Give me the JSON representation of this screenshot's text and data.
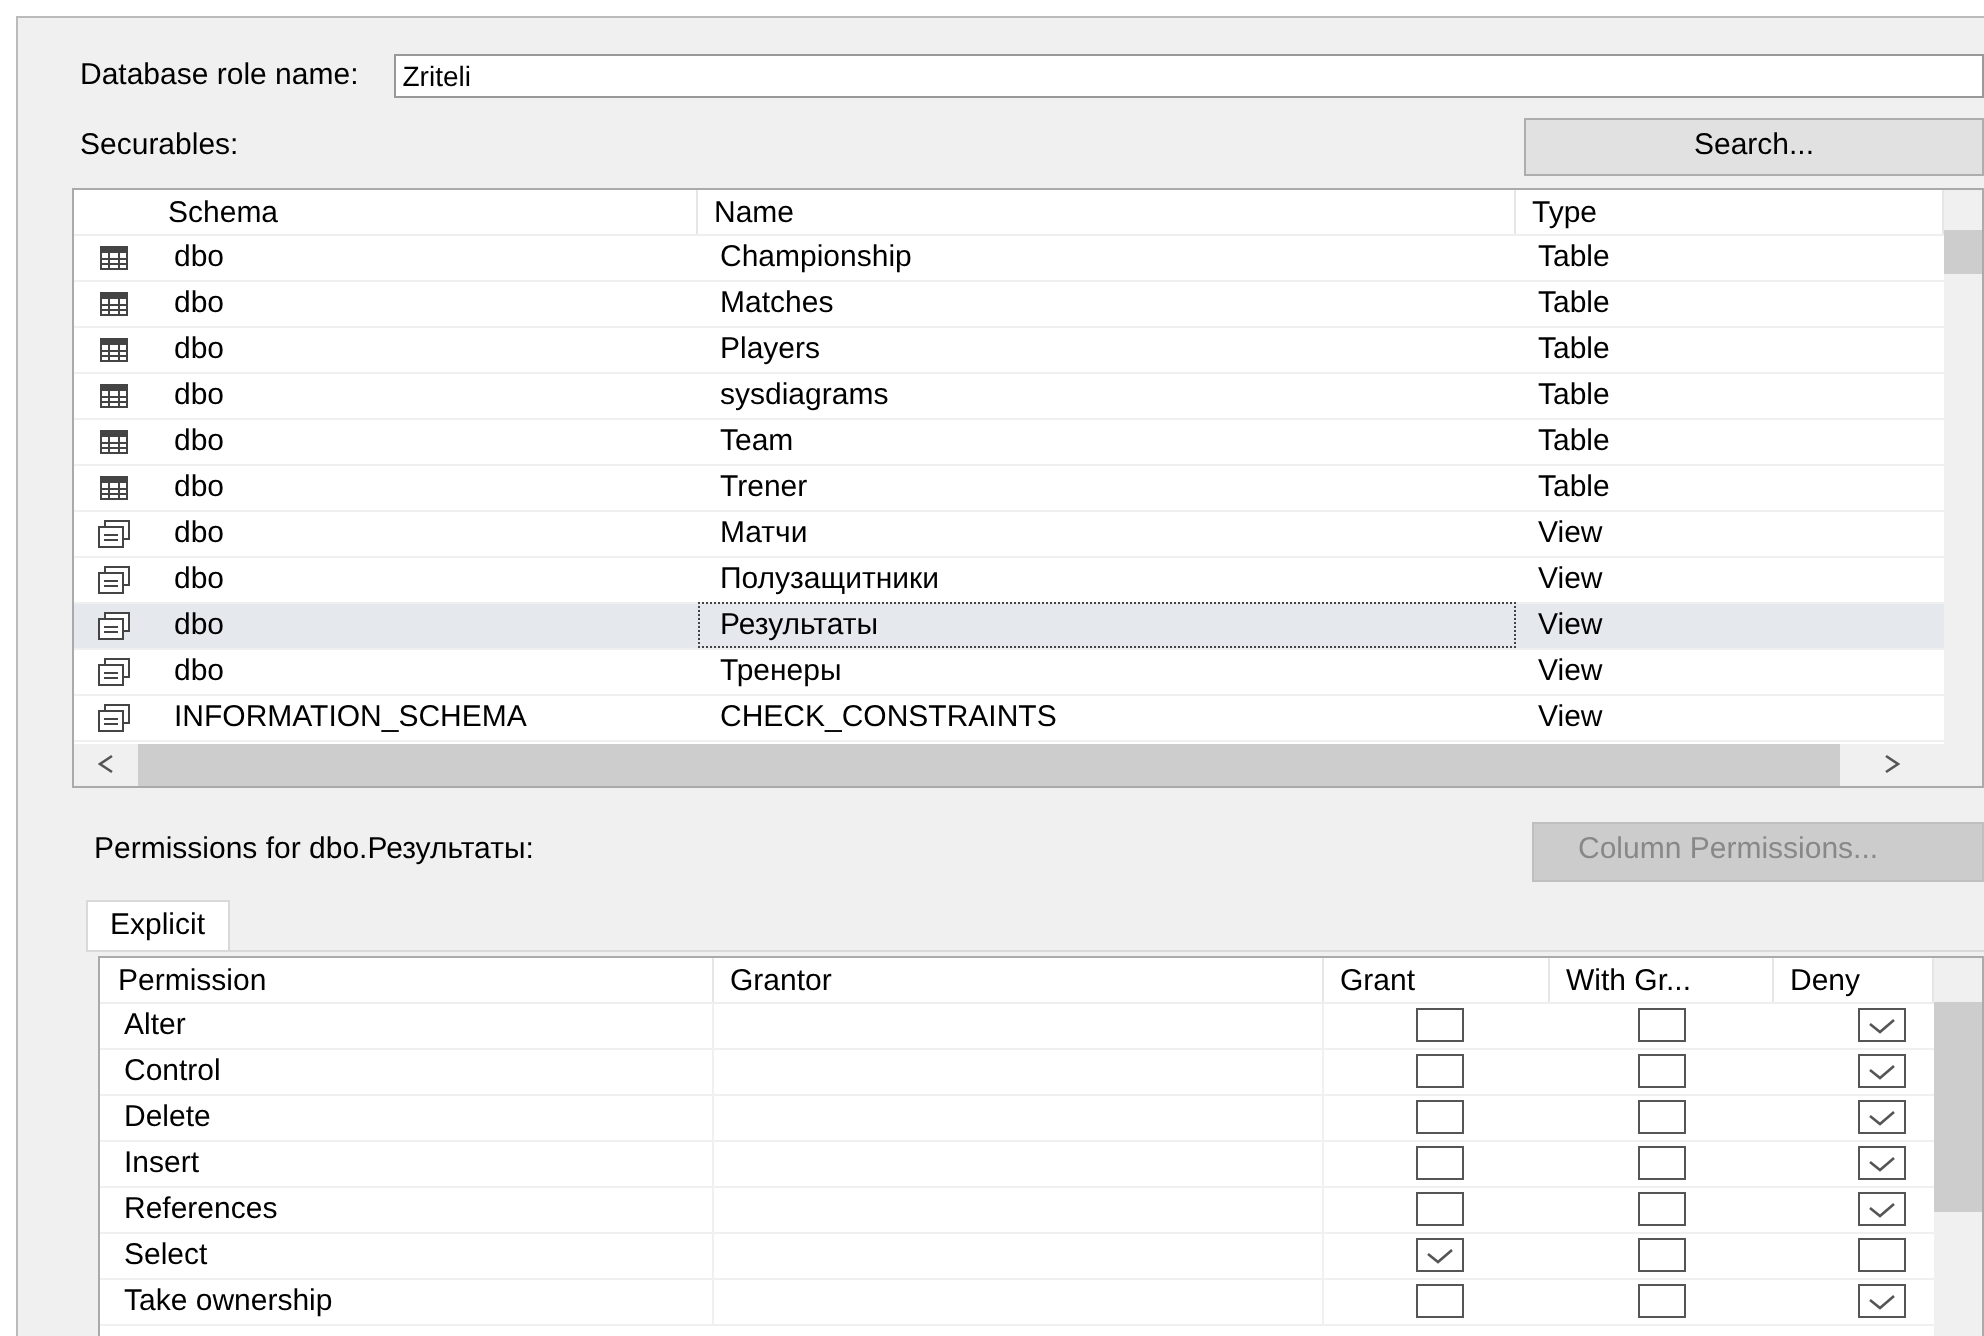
{
  "role_name": {
    "label": "Database role name:",
    "value": "Zriteli"
  },
  "securables": {
    "label": "Securables:",
    "search_button": "Search...",
    "columns": [
      "Schema",
      "Name",
      "Type"
    ],
    "rows": [
      {
        "kind": "table",
        "schema": "dbo",
        "name": "Championship",
        "type": "Table",
        "selected": false
      },
      {
        "kind": "table",
        "schema": "dbo",
        "name": "Matches",
        "type": "Table",
        "selected": false
      },
      {
        "kind": "table",
        "schema": "dbo",
        "name": "Players",
        "type": "Table",
        "selected": false
      },
      {
        "kind": "table",
        "schema": "dbo",
        "name": "sysdiagrams",
        "type": "Table",
        "selected": false
      },
      {
        "kind": "table",
        "schema": "dbo",
        "name": "Team",
        "type": "Table",
        "selected": false
      },
      {
        "kind": "table",
        "schema": "dbo",
        "name": "Trener",
        "type": "Table",
        "selected": false
      },
      {
        "kind": "view",
        "schema": "dbo",
        "name": "Матчи",
        "type": "View",
        "selected": false
      },
      {
        "kind": "view",
        "schema": "dbo",
        "name": "Полузащитники",
        "type": "View",
        "selected": false
      },
      {
        "kind": "view",
        "schema": "dbo",
        "name": "Результаты",
        "type": "View",
        "selected": true
      },
      {
        "kind": "view",
        "schema": "dbo",
        "name": "Тренеры",
        "type": "View",
        "selected": false
      },
      {
        "kind": "view",
        "schema": "INFORMATION_SCHEMA",
        "name": "CHECK_CONSTRAINTS",
        "type": "View",
        "selected": false
      }
    ]
  },
  "permissions": {
    "label": "Permissions for dbo.Результаты:",
    "column_permissions_button": {
      "label": "Column Permissions...",
      "disabled": true
    },
    "tabs": [
      {
        "label": "Explicit",
        "selected": true
      }
    ],
    "columns": [
      "Permission",
      "Grantor",
      "Grant",
      "With Gr...",
      "Deny"
    ],
    "rows": [
      {
        "permission": "Alter",
        "grant": false,
        "with_grant": false,
        "deny": true
      },
      {
        "permission": "Control",
        "grant": false,
        "with_grant": false,
        "deny": true
      },
      {
        "permission": "Delete",
        "grant": false,
        "with_grant": false,
        "deny": true
      },
      {
        "permission": "Insert",
        "grant": false,
        "with_grant": false,
        "deny": true
      },
      {
        "permission": "References",
        "grant": false,
        "with_grant": false,
        "deny": true
      },
      {
        "permission": "Select",
        "grant": true,
        "with_grant": false,
        "deny": false
      },
      {
        "permission": "Take ownership",
        "grant": false,
        "with_grant": false,
        "deny": true
      }
    ]
  }
}
